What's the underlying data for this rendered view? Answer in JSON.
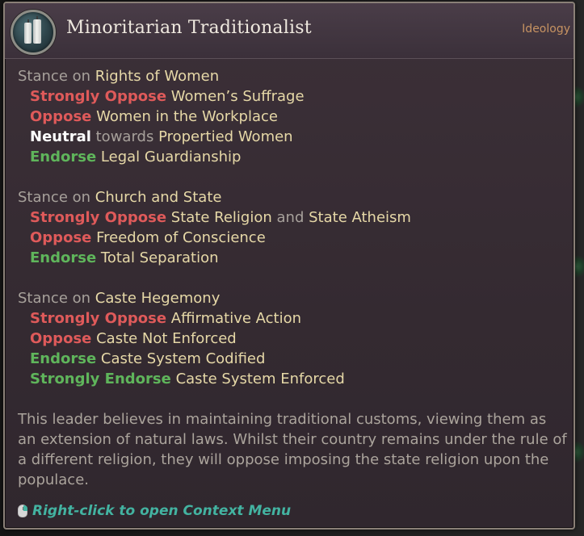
{
  "tooltip": {
    "title": "Minoritarian Traditionalist",
    "category": "Ideology",
    "icon": "candles-icon"
  },
  "labels": {
    "stance": "Stance",
    "on": "on",
    "towards": "towards",
    "and": "and"
  },
  "sections": [
    {
      "topic": "Rights of Women",
      "rows": [
        {
          "stance": "Strongly Oppose",
          "policy": "Women’s Suffrage"
        },
        {
          "stance": "Oppose",
          "policy": "Women in the Workplace"
        },
        {
          "stance": "Neutral",
          "policy": "Propertied Women"
        },
        {
          "stance": "Endorse",
          "policy": "Legal Guardianship"
        }
      ]
    },
    {
      "topic": "Church and State",
      "rows": [
        {
          "stance": "Strongly Oppose",
          "policy": "State Religion",
          "policy2": "State Atheism"
        },
        {
          "stance": "Oppose",
          "policy": "Freedom of Conscience"
        },
        {
          "stance": "Endorse",
          "policy": "Total Separation"
        }
      ]
    },
    {
      "topic": "Caste Hegemony",
      "rows": [
        {
          "stance": "Strongly Oppose",
          "policy": "Affirmative Action"
        },
        {
          "stance": "Oppose",
          "policy": "Caste Not Enforced"
        },
        {
          "stance": "Endorse",
          "policy": "Caste System Codified"
        },
        {
          "stance": "Strongly Endorse",
          "policy": "Caste System Enforced"
        }
      ]
    }
  ],
  "description": "This leader believes in maintaining traditional customs, viewing them as an extension of natural laws. Whilst their country remains under the rule of a different religion, they will oppose imposing the state religion upon the populace.",
  "footer": {
    "icon": "right-mouse-button-icon",
    "text": "Right-click to open Context Menu"
  },
  "colors": {
    "oppose": "#df5a5a",
    "endorse": "#5fb55b",
    "neutral": "#ffffff",
    "policy": "#e6d8a7",
    "category": "#c79362",
    "footer": "#43b3a1"
  }
}
